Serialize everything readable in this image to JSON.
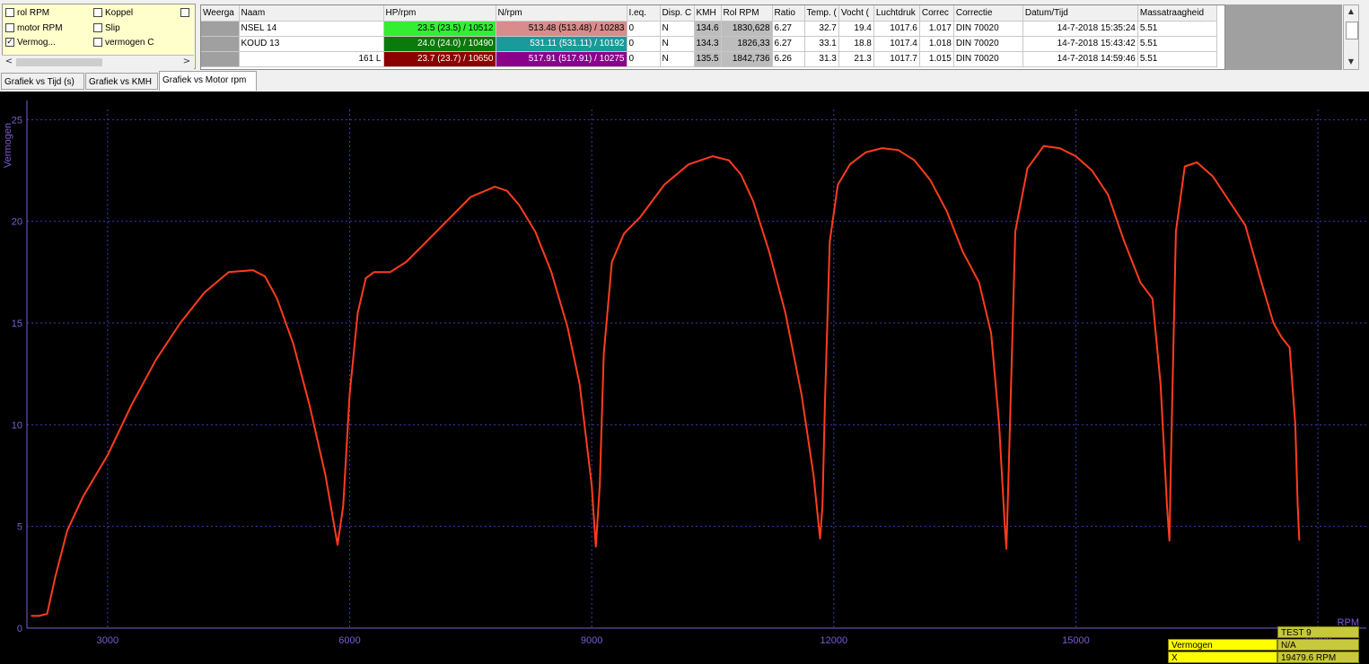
{
  "checkboxes": [
    {
      "label": "rol RPM",
      "checked": false
    },
    {
      "label": "Koppel",
      "checked": false
    },
    {
      "label": "",
      "checked": false
    },
    {
      "label": "motor RPM",
      "checked": false
    },
    {
      "label": "Slip",
      "checked": false
    },
    {
      "label": "Vermog...",
      "checked": true
    },
    {
      "label": "vermogen C",
      "checked": false
    }
  ],
  "hscroll": {
    "left": "<",
    "right": ">"
  },
  "table": {
    "headers": [
      "Weerga",
      "Naam",
      "HP/rpm",
      "N/rpm",
      "I.eq.",
      "Disp. C",
      "KMH",
      "Rol RPM",
      "Ratio",
      "Temp. (",
      "Vocht (",
      "Luchtdruk",
      "Correc",
      "Correctie",
      "Datum/Tijd",
      "Massatraagheid"
    ],
    "rows": [
      {
        "weerga": "",
        "naam": "NSEL 14",
        "hp": "23.5 (23.5) / 10512",
        "hp_color": "#33ee33",
        "n": "513.48 (513.48) / 10283",
        "n_color": "#d98c8c",
        "ieq": "0",
        "disp": "N",
        "kmh": "134.6",
        "rol": "1830,628",
        "ratio": "6.27",
        "temp": "32.7",
        "vocht": "19.4",
        "lucht": "1017.6",
        "corr": "1.017",
        "correctie": "DIN 70020",
        "datum": "14-7-2018 15:35:24",
        "massa": "5.51"
      },
      {
        "weerga": "",
        "naam": "KOUD 13",
        "hp": "24.0 (24.0) / 10490",
        "hp_color": "#0a7a0a",
        "n": "531.11 (531.11) / 10192",
        "n_color": "#1a9a9a",
        "ieq": "0",
        "disp": "N",
        "kmh": "134.3",
        "rol": "1826,33",
        "ratio": "6.27",
        "temp": "33.1",
        "vocht": "18.8",
        "lucht": "1017.4",
        "corr": "1.018",
        "correctie": "DIN 70020",
        "datum": "14-7-2018 15:43:42",
        "massa": "5.51"
      },
      {
        "weerga": "",
        "naam": "161 L",
        "hp": "23.7 (23.7) / 10650",
        "hp_color": "#8b0000",
        "n": "517.91 (517.91) / 10275",
        "n_color": "#8b008b",
        "ieq": "0",
        "disp": "N",
        "kmh": "135.5",
        "rol": "1842,736",
        "ratio": "6.26",
        "temp": "31.3",
        "vocht": "21.3",
        "lucht": "1017.7",
        "corr": "1.015",
        "correctie": "DIN 70020",
        "datum": "14-7-2018 14:59:46",
        "massa": "5.51"
      }
    ]
  },
  "vscroll": {
    "up": "▲",
    "down": "▼"
  },
  "tabs": [
    "Grafiek vs Tijd (s)",
    "Grafiek vs KMH",
    "Grafiek vs Motor rpm"
  ],
  "active_tab": 2,
  "chart_data": {
    "type": "line",
    "ylabel": "Vermogen",
    "xlabel": "RPM",
    "xlim": [
      2000,
      18600
    ],
    "ylim": [
      0,
      25.5
    ],
    "x_ticks": [
      3000,
      6000,
      9000,
      12000,
      15000,
      18000
    ],
    "y_ticks": [
      0,
      5,
      10,
      15,
      20,
      25
    ],
    "grid": true,
    "series": [
      {
        "color": "#ff3c1e",
        "x": [
          2050,
          2150,
          2250,
          2350,
          2500,
          2700,
          3000,
          3300,
          3600,
          3900,
          4200,
          4500,
          4800,
          4950,
          5100,
          5300,
          5500,
          5700,
          5850,
          5920,
          6000,
          6100,
          6200,
          6300,
          6500,
          6700,
          6900,
          7200,
          7500,
          7800,
          7950,
          8100,
          8300,
          8500,
          8700,
          8850,
          9000,
          9050,
          9100,
          9150,
          9250,
          9400,
          9600,
          9900,
          10200,
          10500,
          10700,
          10850,
          11000,
          11200,
          11400,
          11600,
          11750,
          11830,
          11860,
          11890,
          11950,
          12050,
          12200,
          12400,
          12600,
          12800,
          13000,
          13200,
          13400,
          13600,
          13800,
          13950,
          14050,
          14120,
          14140,
          14170,
          14250,
          14400,
          14600,
          14800,
          15000,
          15200,
          15400,
          15600,
          15800,
          15950,
          16050,
          16130,
          16160,
          16180,
          16240,
          16350,
          16500,
          16700,
          16900,
          17100,
          17300,
          17450,
          17550,
          17650,
          17720,
          17750,
          17770
        ],
        "y": [
          0.6,
          0.6,
          0.7,
          2.5,
          4.8,
          6.5,
          8.5,
          11.0,
          13.2,
          15.0,
          16.5,
          17.5,
          17.6,
          17.3,
          16.2,
          14.0,
          11.0,
          7.5,
          4.1,
          6.0,
          11.5,
          15.5,
          17.2,
          17.5,
          17.5,
          18.0,
          18.8,
          20.0,
          21.2,
          21.7,
          21.5,
          20.8,
          19.5,
          17.5,
          14.8,
          12.0,
          7.0,
          4.0,
          7.0,
          13.5,
          18.0,
          19.4,
          20.2,
          21.8,
          22.8,
          23.2,
          23.0,
          22.3,
          21.0,
          18.5,
          15.5,
          11.5,
          7.5,
          4.4,
          6.0,
          11.0,
          19.0,
          21.8,
          22.8,
          23.4,
          23.6,
          23.5,
          23.0,
          22.0,
          20.5,
          18.5,
          17.0,
          14.5,
          10.0,
          5.0,
          3.9,
          8.0,
          19.5,
          22.6,
          23.7,
          23.6,
          23.2,
          22.5,
          21.3,
          19.0,
          17.0,
          16.2,
          12.0,
          6.0,
          4.3,
          8.5,
          19.5,
          22.7,
          22.9,
          22.2,
          21.0,
          19.8,
          17.0,
          15.0,
          14.3,
          13.8,
          10.0,
          6.0,
          4.3
        ]
      }
    ]
  },
  "info": {
    "title": "TEST  9",
    "r1_label": "Vermogen",
    "r1_value": "N/A",
    "r2_label": "X",
    "r2_value": "19479.6 RPM"
  },
  "colors": {
    "grid": "#3c3cb4",
    "axis": "#7b5bd6",
    "label": "#7b5bd6"
  }
}
